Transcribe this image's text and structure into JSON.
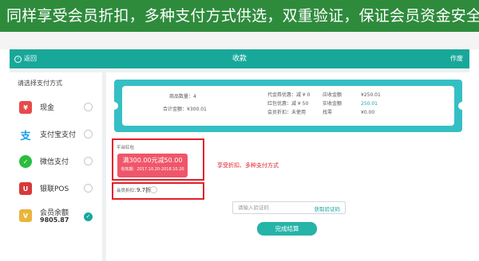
{
  "banner": {
    "text": "同样享受会员折扣，多种支付方式供选，双重验证，保证会员资金安全"
  },
  "header": {
    "back_label": "返回",
    "title": "收款",
    "void_label": "作废"
  },
  "payment": {
    "title": "请选择支付方式",
    "items": [
      {
        "label": "现金",
        "icon": "cash-icon",
        "color": "#e84a4a",
        "selected": false
      },
      {
        "label": "支付宝支付",
        "icon": "alipay-icon",
        "color": "#1aa0e8",
        "selected": false
      },
      {
        "label": "微信支付",
        "icon": "wechat-icon",
        "color": "#2bbd3f",
        "selected": false
      },
      {
        "label": "银联POS",
        "icon": "unionpay-icon",
        "color": "#d8393a",
        "selected": false
      },
      {
        "label": "会员余额",
        "sub": "9805.87",
        "icon": "vip-card-icon",
        "color": "#e9b53a",
        "selected": true
      }
    ]
  },
  "summary": {
    "goods_count_label": "商品数量：",
    "goods_count": "4",
    "total_label": "合计金额：",
    "total": "¥300.01",
    "coupon_discount_label": "代金券优惠：",
    "coupon_discount": "减 ¥ 0",
    "redpacket_label": "红包优惠：",
    "redpacket": "减 ¥ 50",
    "member_discount_label": "会员折扣：",
    "member_discount": "未使用",
    "receivable_label": "应收金额",
    "receivable": "¥250.01",
    "received_label": "实收金额",
    "received": "250.01",
    "change_label": "找零",
    "change": "¥0.00"
  },
  "redpacket_section": {
    "label": "平台红包",
    "coupon_title": "满300.00元减50.00",
    "coupon_validity": "有效期：2017.10.20-2018.10.20"
  },
  "annotation": "享受折扣、多种支付方式",
  "discount": {
    "label": "会员折扣：",
    "value": "9.7折"
  },
  "verify": {
    "placeholder": "请输入验证码",
    "get_code": "获取验证码"
  },
  "submit_label": "完成结算",
  "colors": {
    "brand_teal": "#18a89a",
    "banner_green": "#2e8b3c",
    "highlight_red": "#e0202a",
    "coupon_pink": "#f0566a"
  }
}
